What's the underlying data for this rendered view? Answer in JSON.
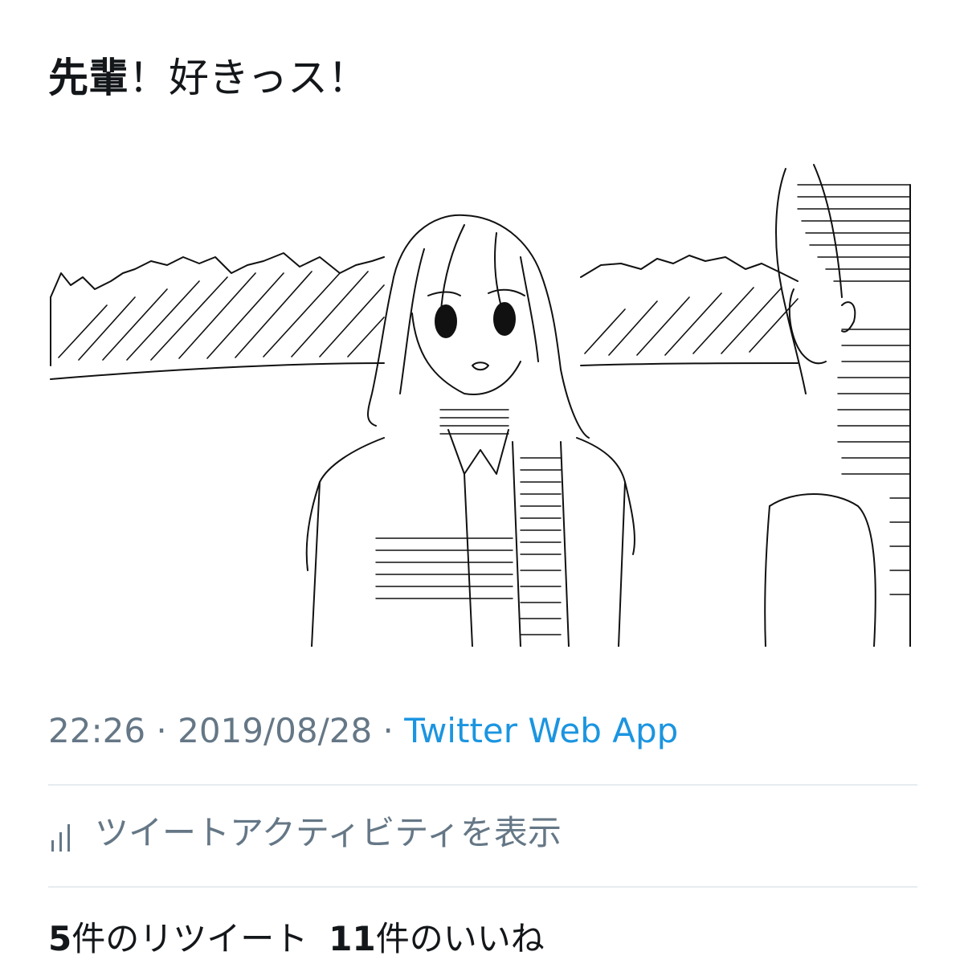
{
  "tweet": {
    "text_bold": "先輩",
    "text_rest": "！好きっス！"
  },
  "image": {
    "description_icon": "sketch-illustration"
  },
  "meta": {
    "time": "22:26",
    "separator": " · ",
    "date": "2019/08/28",
    "app": "Twitter Web App"
  },
  "activity": {
    "icon": "bar-chart-icon",
    "label": "ツイートアクティビティを表示"
  },
  "stats": {
    "retweets_count": "5",
    "retweets_label": "件のリツイート",
    "likes_count": "11",
    "likes_label": "件のいいね"
  },
  "colors": {
    "text": "#14171a",
    "secondary": "#657786",
    "link": "#1b95e0",
    "divider": "#e6ecf0"
  }
}
